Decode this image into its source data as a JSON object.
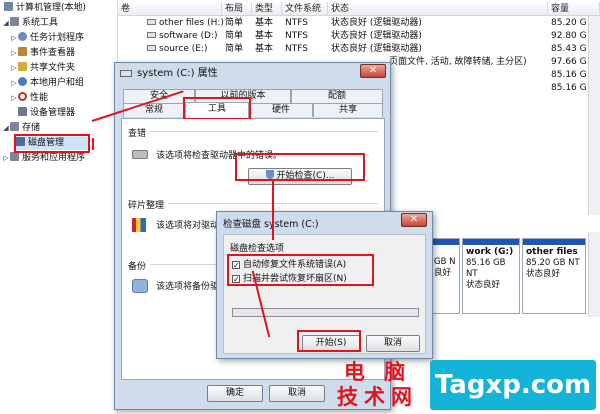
{
  "tree": {
    "header": "计算机管理(本地)",
    "items": [
      {
        "label": "系统工具",
        "icon": "gear-icon",
        "color": "#7a8797"
      },
      {
        "label": "任务计划程序",
        "icon": "clock-icon",
        "color": "#6a8ac0"
      },
      {
        "label": "事件查看器",
        "icon": "event-icon",
        "color": "#b9863a"
      },
      {
        "label": "共享文件夹",
        "icon": "folder-icon",
        "color": "#d6a93a"
      },
      {
        "label": "本地用户和组",
        "icon": "users-icon",
        "color": "#4c7cc0"
      },
      {
        "label": "性能",
        "icon": "gauge-icon",
        "color": "#c0302a"
      },
      {
        "label": "设备管理器",
        "icon": "device-icon",
        "color": "#6b7a8a"
      },
      {
        "label": "存储",
        "icon": "storage-icon",
        "color": "#7a8797"
      },
      {
        "label": "磁盘管理",
        "icon": "disk-icon",
        "color": "#4d6c9a"
      },
      {
        "label": "服务和应用程序",
        "icon": "services-icon",
        "color": "#7a8797"
      }
    ]
  },
  "table": {
    "columns": [
      "卷",
      "布局",
      "类型",
      "文件系统",
      "状态",
      "容量"
    ],
    "rows": [
      {
        "vol": "other files (H:)",
        "layout": "简单",
        "type": "基本",
        "fs": "NTFS",
        "status": "状态良好 (逻辑驱动器)",
        "cap": "85.20 G"
      },
      {
        "vol": "software (D:)",
        "layout": "简单",
        "type": "基本",
        "fs": "NTFS",
        "status": "状态良好 (逻辑驱动器)",
        "cap": "92.80 G"
      },
      {
        "vol": "source (E:)",
        "layout": "简单",
        "type": "基本",
        "fs": "NTFS",
        "status": "状态良好 (逻辑驱动器)",
        "cap": "85.43 G"
      },
      {
        "vol": "",
        "layout": "",
        "type": "",
        "fs": "",
        "status": "页面文件, 活动, 故障转储, 主分区)",
        "cap": "97.66 G"
      },
      {
        "vol": "",
        "layout": "",
        "type": "",
        "fs": "",
        "status": "",
        "cap": "85.16 G"
      },
      {
        "vol": "",
        "layout": "",
        "type": "",
        "fs": "",
        "status": "",
        "cap": "85.16 G"
      }
    ]
  },
  "diskmap": {
    "partial_left": {
      "line1": "GB N",
      "line2": "良好"
    },
    "volumes": [
      {
        "name": "work (G:)",
        "size": "85.16 GB NT",
        "status": "状态良好"
      },
      {
        "name": "other files",
        "size": "85.20 GB NT",
        "status": "状态良好"
      }
    ]
  },
  "props": {
    "title": "system (C:) 属性",
    "close": "✕",
    "tabs_top": [
      "安全",
      "以前的版本",
      "配额"
    ],
    "tabs_bottom": [
      "常规",
      "工具",
      "硬件",
      "共享"
    ],
    "check": {
      "title": "查错",
      "desc": "该选项将检查驱动器中的错误。",
      "button": "开始检查(C)..."
    },
    "defrag": {
      "title": "碎片整理",
      "desc": "该选项将对驱动器中的文件进行碎片整理。"
    },
    "backup": {
      "title": "备份",
      "desc": "该选项将备份驱动器中的文件。"
    },
    "ok": "确定",
    "cancel": "取消"
  },
  "check_dialog": {
    "title": "检查磁盘 system (C:)",
    "group": "磁盘检查选项",
    "opt1": "自动修复文件系统错误(A)",
    "opt2": "扫描并尝试恢复坏扇区(N)",
    "check_mark": "✓",
    "start": "开始(S)",
    "cancel": "取消"
  },
  "watermark": {
    "site": "Tagxp.com",
    "cn1": "电 脑",
    "cn2": "技术网"
  },
  "colors": {
    "accent_red": "#e0141e",
    "volume_bar": "#1f55b4",
    "watermark_blue": "#14b4d8"
  }
}
